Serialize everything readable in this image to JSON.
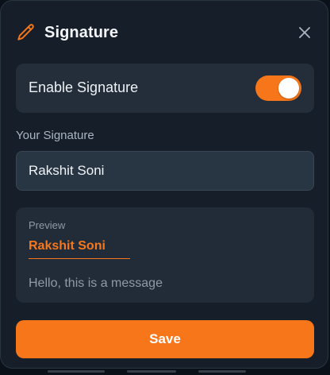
{
  "dialog": {
    "title": "Signature",
    "icons": {
      "title_icon": "pencil-icon",
      "close_icon": "close-icon"
    }
  },
  "enable_signature": {
    "label": "Enable Signature",
    "enabled": true
  },
  "signature_field": {
    "label": "Your Signature",
    "value": "Rakshit Soni"
  },
  "preview": {
    "label": "Preview",
    "signature": "Rakshit Soni",
    "message": "Hello, this is a message"
  },
  "actions": {
    "save_label": "Save"
  },
  "colors": {
    "accent": "#f7761a",
    "dialog_background": "#161f29",
    "card_background": "#232e3a",
    "text_primary": "#f3f5f8",
    "text_muted": "#8f9aa8"
  }
}
